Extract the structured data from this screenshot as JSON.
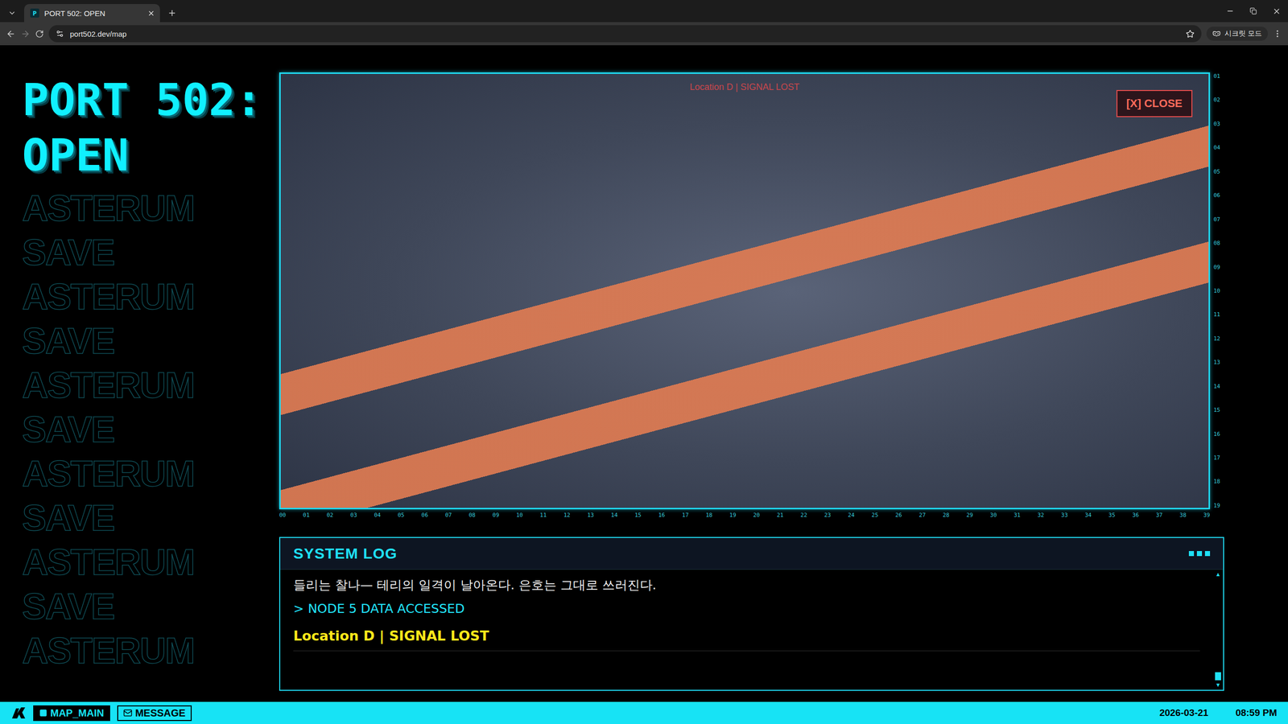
{
  "browser": {
    "tab": {
      "title": "PORT 502: OPEN",
      "favicon": "P",
      "selected": true
    },
    "url": "port502.dev/map",
    "incognito": "시크릿 모드"
  },
  "sidebar": {
    "title": "PORT 502: OPEN",
    "watermark": [
      "ASTERUM",
      "SAVE",
      "ASTERUM",
      "SAVE",
      "ASTERUM",
      "SAVE",
      "ASTERUM",
      "SAVE",
      "ASTERUM",
      "SAVE",
      "ASTERUM"
    ]
  },
  "viewer": {
    "label": "Location D | SIGNAL LOST",
    "close": "[X] CLOSE",
    "ruler_y": [
      "01",
      "02",
      "03",
      "04",
      "05",
      "06",
      "07",
      "08",
      "09",
      "10",
      "11",
      "12",
      "13",
      "14",
      "15",
      "16",
      "17",
      "18",
      "19"
    ],
    "ruler_x": [
      "00",
      "01",
      "02",
      "03",
      "04",
      "05",
      "06",
      "07",
      "08",
      "09",
      "10",
      "11",
      "12",
      "13",
      "14",
      "15",
      "16",
      "17",
      "18",
      "19",
      "20",
      "21",
      "22",
      "23",
      "24",
      "25",
      "26",
      "27",
      "28",
      "29",
      "30",
      "31",
      "32",
      "33",
      "34",
      "35",
      "36",
      "37",
      "38",
      "39"
    ]
  },
  "log": {
    "title": "SYSTEM LOG",
    "entries": [
      {
        "kind": "narration",
        "text": "들리는 찰나— 테리의 일격이 날아온다. 은호는 그대로 쓰러진다."
      },
      {
        "kind": "system",
        "text": "> NODE 5 DATA ACCESSED"
      },
      {
        "kind": "alert",
        "text": "Location D | SIGNAL LOST"
      }
    ],
    "scroll": {
      "up": "▲",
      "down": "▼",
      "level": 1
    }
  },
  "status_bar": {
    "tabs": [
      {
        "label": "MAP_MAIN",
        "kind": "map",
        "selected": true
      },
      {
        "label": "MESSAGE",
        "kind": "message",
        "selected": false
      }
    ],
    "date": "2026-03-21",
    "time": "08:59 PM"
  }
}
